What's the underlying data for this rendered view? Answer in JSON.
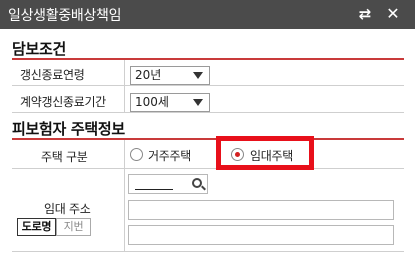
{
  "window": {
    "title": "일상생활중배상책임",
    "swap_icon": "swap-arrows-icon",
    "close_icon": "close-icon"
  },
  "coverage": {
    "section_title": "담보조건",
    "rows": [
      {
        "label": "갱신종료연령",
        "value": "20년"
      },
      {
        "label": "계약갱신종료기간",
        "value": "100세"
      }
    ]
  },
  "insured_house": {
    "section_title": "피보험자 주택정보",
    "house_type": {
      "label": "주택 구분",
      "options": [
        {
          "label": "거주주택",
          "checked": false
        },
        {
          "label": "임대주택",
          "checked": true
        }
      ],
      "highlight_color": "#e8101a"
    },
    "address": {
      "label": "임대 주소",
      "zip_placeholder": "",
      "address_type_buttons": [
        {
          "label": "도로명",
          "active": true
        },
        {
          "label": "지번",
          "active": false
        }
      ]
    }
  },
  "colors": {
    "titlebar": "#4b4b4b",
    "accent_line": "#c93a3a",
    "selected_radio": "#d32020"
  }
}
